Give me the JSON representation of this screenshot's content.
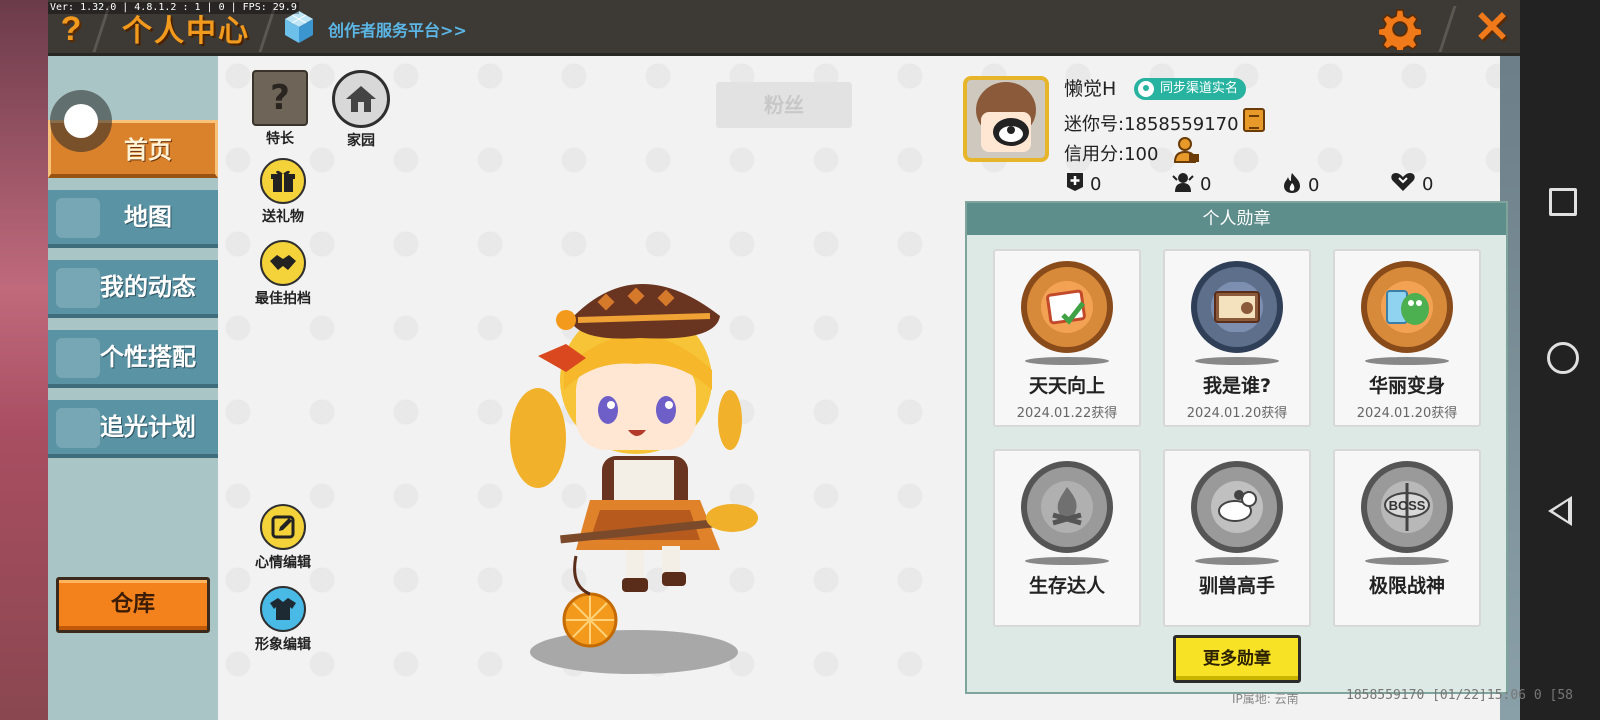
{
  "debug": {
    "overlay_text": "Ver: 1.32.0 | 4.8.1.2 : 1 | 0 | FPS: 29.9"
  },
  "header": {
    "title": "个人中心",
    "creator_link": "创作者服务平台>>",
    "help_icon": "question-mark-icon",
    "settings_icon": "gear-icon",
    "close_icon": "close-x-icon"
  },
  "sidebar": {
    "items": [
      {
        "label": "首页",
        "icon": "home-icon",
        "active": true
      },
      {
        "label": "地图",
        "icon": "map-icon",
        "active": false
      },
      {
        "label": "我的动态",
        "icon": "bell-icon",
        "active": false
      },
      {
        "label": "个性搭配",
        "icon": "outfit-icon",
        "active": false
      },
      {
        "label": "追光计划",
        "icon": "plan-icon",
        "active": false
      }
    ],
    "warehouse_label": "仓库"
  },
  "actions": {
    "specialty": "特长",
    "homeland": "家园",
    "send_gift": "送礼物",
    "best_partner": "最佳拍档",
    "mood_edit": "心情编辑",
    "avatar_edit": "形象编辑",
    "fans": "粉丝"
  },
  "profile": {
    "nickname": "懒觉H",
    "sync_badge": "同步渠道实名",
    "mini_id": "迷你号:1858559170",
    "credit": "信用分:100",
    "stats": [
      {
        "icon": "plus-icon",
        "value": "0"
      },
      {
        "icon": "person-icon",
        "value": "0"
      },
      {
        "icon": "flame-icon",
        "value": "0"
      },
      {
        "icon": "heart-icon",
        "value": "0"
      }
    ]
  },
  "medals": {
    "title": "个人勋章",
    "items": [
      {
        "name": "天天向上",
        "date": "2024.01.22获得",
        "earned": true,
        "icon": "calendar-medal-icon"
      },
      {
        "name": "我是谁?",
        "date": "2024.01.20获得",
        "earned": true,
        "icon": "idcard-medal-icon"
      },
      {
        "name": "华丽变身",
        "date": "2024.01.20获得",
        "earned": true,
        "icon": "dino-medal-icon"
      },
      {
        "name": "生存达人",
        "date": "",
        "earned": false,
        "icon": "campfire-medal-icon"
      },
      {
        "name": "驯兽高手",
        "date": "",
        "earned": false,
        "icon": "beast-medal-icon"
      },
      {
        "name": "极限战神",
        "date": "",
        "earned": false,
        "icon": "boss-medal-icon"
      }
    ],
    "more_label": "更多勋章"
  },
  "footer": {
    "ip_location": "IP属地: 云南",
    "info": "1858559170   [01/22]15:06 0   [58"
  },
  "colors": {
    "accent_orange": "#f29a1e",
    "sidebar_tab": "#5a93a4",
    "active_tab": "#d9822b",
    "badge_teal": "#27b3a0",
    "medal_header": "#5e8e8c",
    "button_yellow": "#f7e226"
  }
}
